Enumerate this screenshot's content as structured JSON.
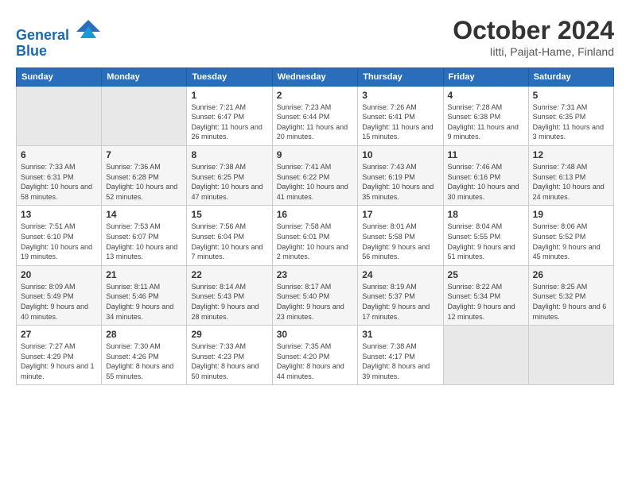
{
  "header": {
    "logo_line1": "General",
    "logo_line2": "Blue",
    "month": "October 2024",
    "location": "Iitti, Paijat-Hame, Finland"
  },
  "days_of_week": [
    "Sunday",
    "Monday",
    "Tuesday",
    "Wednesday",
    "Thursday",
    "Friday",
    "Saturday"
  ],
  "weeks": [
    [
      {
        "num": "",
        "sunrise": "",
        "sunset": "",
        "daylight": ""
      },
      {
        "num": "",
        "sunrise": "",
        "sunset": "",
        "daylight": ""
      },
      {
        "num": "1",
        "sunrise": "Sunrise: 7:21 AM",
        "sunset": "Sunset: 6:47 PM",
        "daylight": "Daylight: 11 hours and 26 minutes."
      },
      {
        "num": "2",
        "sunrise": "Sunrise: 7:23 AM",
        "sunset": "Sunset: 6:44 PM",
        "daylight": "Daylight: 11 hours and 20 minutes."
      },
      {
        "num": "3",
        "sunrise": "Sunrise: 7:26 AM",
        "sunset": "Sunset: 6:41 PM",
        "daylight": "Daylight: 11 hours and 15 minutes."
      },
      {
        "num": "4",
        "sunrise": "Sunrise: 7:28 AM",
        "sunset": "Sunset: 6:38 PM",
        "daylight": "Daylight: 11 hours and 9 minutes."
      },
      {
        "num": "5",
        "sunrise": "Sunrise: 7:31 AM",
        "sunset": "Sunset: 6:35 PM",
        "daylight": "Daylight: 11 hours and 3 minutes."
      }
    ],
    [
      {
        "num": "6",
        "sunrise": "Sunrise: 7:33 AM",
        "sunset": "Sunset: 6:31 PM",
        "daylight": "Daylight: 10 hours and 58 minutes."
      },
      {
        "num": "7",
        "sunrise": "Sunrise: 7:36 AM",
        "sunset": "Sunset: 6:28 PM",
        "daylight": "Daylight: 10 hours and 52 minutes."
      },
      {
        "num": "8",
        "sunrise": "Sunrise: 7:38 AM",
        "sunset": "Sunset: 6:25 PM",
        "daylight": "Daylight: 10 hours and 47 minutes."
      },
      {
        "num": "9",
        "sunrise": "Sunrise: 7:41 AM",
        "sunset": "Sunset: 6:22 PM",
        "daylight": "Daylight: 10 hours and 41 minutes."
      },
      {
        "num": "10",
        "sunrise": "Sunrise: 7:43 AM",
        "sunset": "Sunset: 6:19 PM",
        "daylight": "Daylight: 10 hours and 35 minutes."
      },
      {
        "num": "11",
        "sunrise": "Sunrise: 7:46 AM",
        "sunset": "Sunset: 6:16 PM",
        "daylight": "Daylight: 10 hours and 30 minutes."
      },
      {
        "num": "12",
        "sunrise": "Sunrise: 7:48 AM",
        "sunset": "Sunset: 6:13 PM",
        "daylight": "Daylight: 10 hours and 24 minutes."
      }
    ],
    [
      {
        "num": "13",
        "sunrise": "Sunrise: 7:51 AM",
        "sunset": "Sunset: 6:10 PM",
        "daylight": "Daylight: 10 hours and 19 minutes."
      },
      {
        "num": "14",
        "sunrise": "Sunrise: 7:53 AM",
        "sunset": "Sunset: 6:07 PM",
        "daylight": "Daylight: 10 hours and 13 minutes."
      },
      {
        "num": "15",
        "sunrise": "Sunrise: 7:56 AM",
        "sunset": "Sunset: 6:04 PM",
        "daylight": "Daylight: 10 hours and 7 minutes."
      },
      {
        "num": "16",
        "sunrise": "Sunrise: 7:58 AM",
        "sunset": "Sunset: 6:01 PM",
        "daylight": "Daylight: 10 hours and 2 minutes."
      },
      {
        "num": "17",
        "sunrise": "Sunrise: 8:01 AM",
        "sunset": "Sunset: 5:58 PM",
        "daylight": "Daylight: 9 hours and 56 minutes."
      },
      {
        "num": "18",
        "sunrise": "Sunrise: 8:04 AM",
        "sunset": "Sunset: 5:55 PM",
        "daylight": "Daylight: 9 hours and 51 minutes."
      },
      {
        "num": "19",
        "sunrise": "Sunrise: 8:06 AM",
        "sunset": "Sunset: 5:52 PM",
        "daylight": "Daylight: 9 hours and 45 minutes."
      }
    ],
    [
      {
        "num": "20",
        "sunrise": "Sunrise: 8:09 AM",
        "sunset": "Sunset: 5:49 PM",
        "daylight": "Daylight: 9 hours and 40 minutes."
      },
      {
        "num": "21",
        "sunrise": "Sunrise: 8:11 AM",
        "sunset": "Sunset: 5:46 PM",
        "daylight": "Daylight: 9 hours and 34 minutes."
      },
      {
        "num": "22",
        "sunrise": "Sunrise: 8:14 AM",
        "sunset": "Sunset: 5:43 PM",
        "daylight": "Daylight: 9 hours and 28 minutes."
      },
      {
        "num": "23",
        "sunrise": "Sunrise: 8:17 AM",
        "sunset": "Sunset: 5:40 PM",
        "daylight": "Daylight: 9 hours and 23 minutes."
      },
      {
        "num": "24",
        "sunrise": "Sunrise: 8:19 AM",
        "sunset": "Sunset: 5:37 PM",
        "daylight": "Daylight: 9 hours and 17 minutes."
      },
      {
        "num": "25",
        "sunrise": "Sunrise: 8:22 AM",
        "sunset": "Sunset: 5:34 PM",
        "daylight": "Daylight: 9 hours and 12 minutes."
      },
      {
        "num": "26",
        "sunrise": "Sunrise: 8:25 AM",
        "sunset": "Sunset: 5:32 PM",
        "daylight": "Daylight: 9 hours and 6 minutes."
      }
    ],
    [
      {
        "num": "27",
        "sunrise": "Sunrise: 7:27 AM",
        "sunset": "Sunset: 4:29 PM",
        "daylight": "Daylight: 9 hours and 1 minute."
      },
      {
        "num": "28",
        "sunrise": "Sunrise: 7:30 AM",
        "sunset": "Sunset: 4:26 PM",
        "daylight": "Daylight: 8 hours and 55 minutes."
      },
      {
        "num": "29",
        "sunrise": "Sunrise: 7:33 AM",
        "sunset": "Sunset: 4:23 PM",
        "daylight": "Daylight: 8 hours and 50 minutes."
      },
      {
        "num": "30",
        "sunrise": "Sunrise: 7:35 AM",
        "sunset": "Sunset: 4:20 PM",
        "daylight": "Daylight: 8 hours and 44 minutes."
      },
      {
        "num": "31",
        "sunrise": "Sunrise: 7:38 AM",
        "sunset": "Sunset: 4:17 PM",
        "daylight": "Daylight: 8 hours and 39 minutes."
      },
      {
        "num": "",
        "sunrise": "",
        "sunset": "",
        "daylight": ""
      },
      {
        "num": "",
        "sunrise": "",
        "sunset": "",
        "daylight": ""
      }
    ]
  ]
}
